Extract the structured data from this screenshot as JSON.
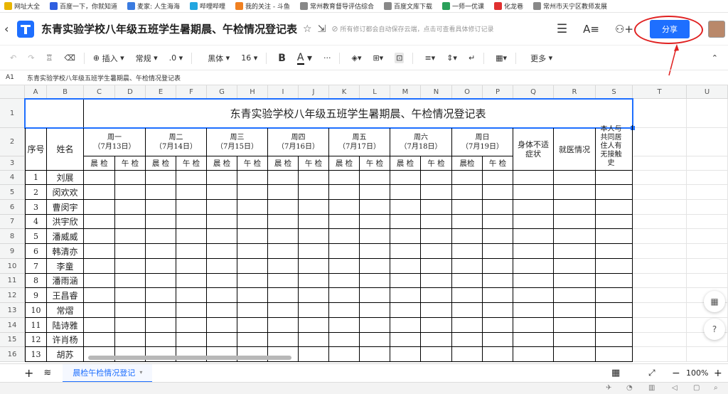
{
  "bookmarks": [
    {
      "label": "网址大全",
      "color": "#e8b500"
    },
    {
      "label": "百度一下，你就知道",
      "color": "#2f5ee0"
    },
    {
      "label": "麦家: 人生海海",
      "color": "#3a7be0"
    },
    {
      "label": "哔哩哔哩",
      "color": "#22a6e0"
    },
    {
      "label": "我的关注 - 斗鱼",
      "color": "#f08020"
    },
    {
      "label": "常州教育督导评估综合",
      "color": "#888888"
    },
    {
      "label": "百度文库下载",
      "color": "#888888"
    },
    {
      "label": "一师一优课",
      "color": "#2aa05a"
    },
    {
      "label": "化龙巷",
      "color": "#e03030"
    },
    {
      "label": "常州市天宁区教师发展",
      "color": "#888888"
    }
  ],
  "header": {
    "doc_title": "东青实验学校八年级五班学生暑期晨、午检情况登记表",
    "autosave_text": "所有修订都会自动保存云端，点击可查看具体修订记录",
    "share_label": "分享"
  },
  "toolbar": {
    "insert_label": "插入",
    "format_label": "常规",
    "decimal_label": ".0",
    "font_label": "黑体",
    "size_label": "16",
    "bold_label": "B",
    "color_label": "A",
    "more_label": "更多"
  },
  "formula_bar": {
    "cell_ref": "A1",
    "value": "东青实验学校八年级五班学生暑期晨、午检情况登记表"
  },
  "columns": [
    "A",
    "B",
    "C",
    "D",
    "E",
    "F",
    "G",
    "H",
    "I",
    "J",
    "K",
    "L",
    "M",
    "N",
    "O",
    "P",
    "Q",
    "R",
    "S",
    "T",
    "U"
  ],
  "rows": [
    "1",
    "2",
    "3",
    "4",
    "5",
    "6",
    "7",
    "8",
    "9",
    "10",
    "11",
    "12",
    "13",
    "14",
    "15",
    "16"
  ],
  "sheet": {
    "title": "东青实验学校八年级五班学生暑期晨、午检情况登记表",
    "seq_header": "序号",
    "name_header": "姓名",
    "days": [
      {
        "day": "周一",
        "date": "（7月13日）"
      },
      {
        "day": "周二",
        "date": "（7月14日）"
      },
      {
        "day": "周三",
        "date": "（7月15日）"
      },
      {
        "day": "周四",
        "date": "（7月16日）"
      },
      {
        "day": "周五",
        "date": "（7月17日）"
      },
      {
        "day": "周六",
        "date": "（7月18日）"
      },
      {
        "day": "周日",
        "date": "（7月19日）"
      }
    ],
    "morning_label": "晨 检",
    "noon_label": "午 检",
    "morning_label_sun": "晨检",
    "symptom_header": "身体不适症状",
    "medical_header": "就医情况",
    "contact_header": "本人与共同居住人有无接触史",
    "students": [
      {
        "seq": "1",
        "name": "刘展"
      },
      {
        "seq": "2",
        "name": "闵欢欢"
      },
      {
        "seq": "3",
        "name": "曹闵宇"
      },
      {
        "seq": "4",
        "name": "洪宇欣"
      },
      {
        "seq": "5",
        "name": "潘威威"
      },
      {
        "seq": "6",
        "name": "韩清亦"
      },
      {
        "seq": "7",
        "name": "李童"
      },
      {
        "seq": "8",
        "name": "潘雨涵"
      },
      {
        "seq": "9",
        "name": "王昌睿"
      },
      {
        "seq": "10",
        "name": "常熠"
      },
      {
        "seq": "11",
        "name": "陆诗雅"
      },
      {
        "seq": "12",
        "name": "许肖杨"
      },
      {
        "seq": "13",
        "name": "胡苏"
      }
    ]
  },
  "sheettabs": {
    "active_tab": "晨检午检情况登记",
    "zoom": "100%"
  },
  "colors": {
    "accent": "#1e6fff",
    "annotation": "#e02020"
  }
}
